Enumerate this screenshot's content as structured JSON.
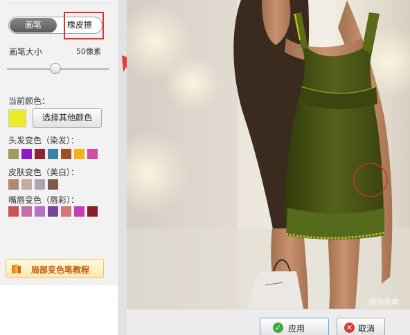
{
  "tools": {
    "brush_tab": "画笔",
    "eraser_tab": "橡皮擦",
    "active_tab": "画笔"
  },
  "brush_size": {
    "label": "画笔大小",
    "value_text": "50像素",
    "slider_fraction": 0.47
  },
  "current_color": {
    "label": "当前颜色：",
    "swatch_color": "#ecea2a",
    "choose_button": "选择其他颜色"
  },
  "hair_colors": {
    "label": "头发变色（染发）：",
    "swatches": [
      "#9e9b5c",
      "#8f19c7",
      "#8a2635",
      "#3a82a3",
      "#a04f1e",
      "#f4b21a",
      "#d24ea3"
    ]
  },
  "skin_colors": {
    "label": "皮肤变色（美白）：",
    "swatches": [
      "#b08a77",
      "#c2aca2",
      "#b1a2b1",
      "#7b5c4b"
    ]
  },
  "lip_colors": {
    "label": "嘴唇变色（唇彩）：",
    "swatches": [
      "#cc5252",
      "#c76ea3",
      "#b86fc6",
      "#764893",
      "#d4757b",
      "#c43fb4",
      "#8b1e2d"
    ]
  },
  "tutorial": {
    "label": "局部变色笔教程",
    "icon": "book-icon"
  },
  "canvas": {
    "watermark": "搜狗指南",
    "dress_color": "#4a5514",
    "highlight_color": "#e8d834",
    "brush_cursor_color": "#c0392b"
  },
  "actions": {
    "apply": "应用",
    "cancel": "取消"
  },
  "annotation": {
    "highlight_color": "#e03030"
  }
}
